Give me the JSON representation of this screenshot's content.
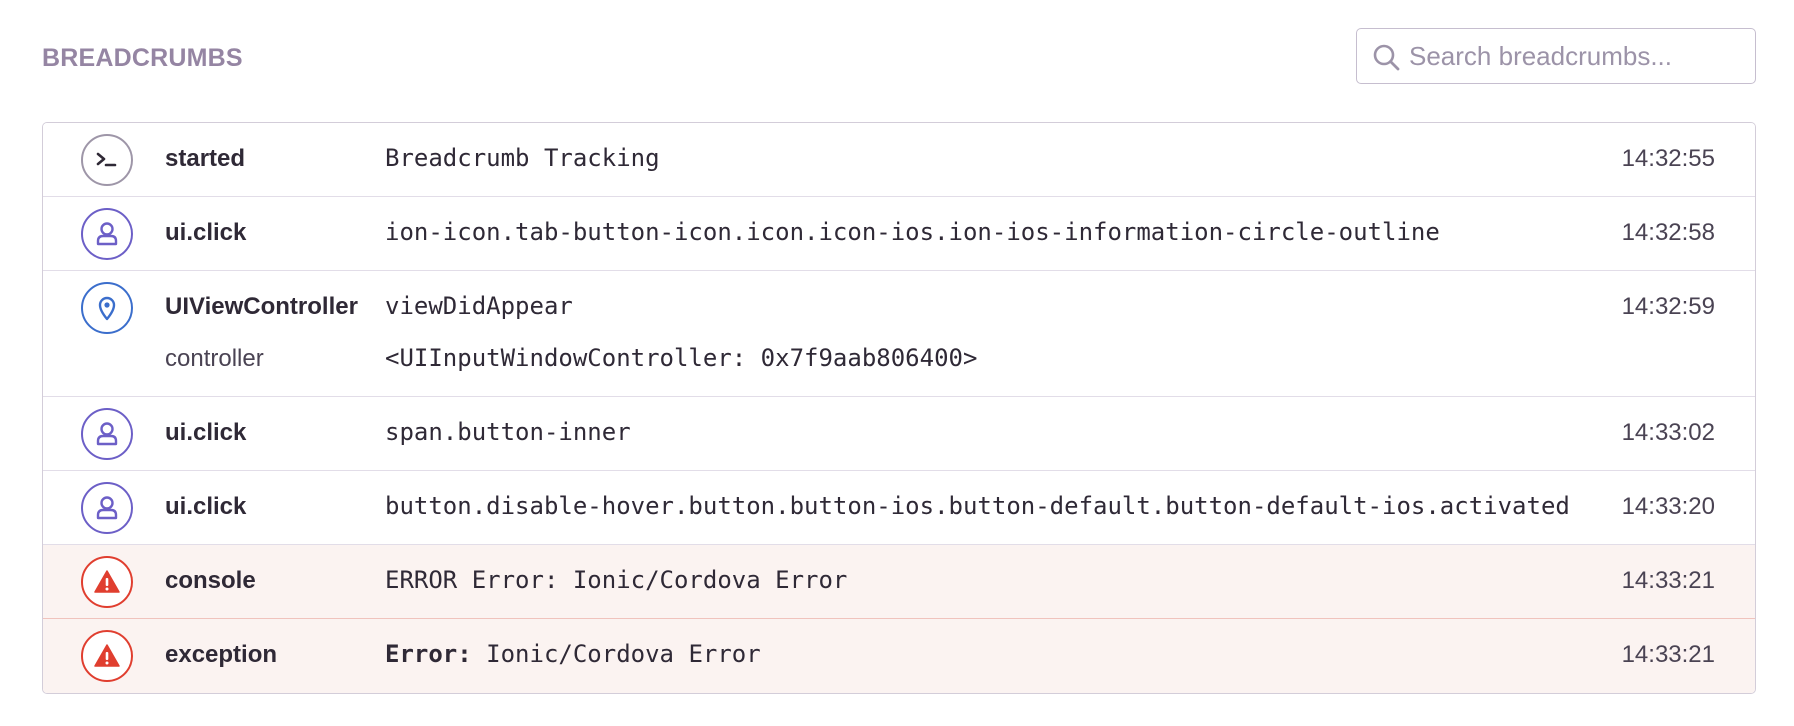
{
  "header": {
    "title": "BREADCRUMBS",
    "search_placeholder": "Search breadcrumbs..."
  },
  "crumbs": [
    {
      "type": "default",
      "icon": "terminal-icon",
      "category": "started",
      "message": "Breadcrumb Tracking",
      "time": "14:32:55"
    },
    {
      "type": "user",
      "icon": "user-icon",
      "category": "ui.click",
      "message": "ion-icon.tab-button-icon.icon.icon-ios.ion-ios-information-circle-outline",
      "time": "14:32:58"
    },
    {
      "type": "navigation",
      "icon": "location-pin-icon",
      "category": "UIViewController",
      "message": "viewDidAppear",
      "time": "14:32:59",
      "data_key": "controller",
      "data_value": "<UIInputWindowController: 0x7f9aab806400>"
    },
    {
      "type": "user",
      "icon": "user-icon",
      "category": "ui.click",
      "message": "span.button-inner",
      "time": "14:33:02"
    },
    {
      "type": "user",
      "icon": "user-icon",
      "category": "ui.click",
      "message": "button.disable-hover.button.button-ios.button-default.button-default-ios.activated",
      "time": "14:33:20"
    },
    {
      "type": "error",
      "icon": "warning-icon",
      "category": "console",
      "message": "ERROR Error: Ionic/Cordova Error",
      "time": "14:33:21"
    },
    {
      "type": "error",
      "icon": "warning-icon",
      "category": "exception",
      "message_prefix": "Error:",
      "message": "Ionic/Cordova Error",
      "time": "14:33:21"
    }
  ],
  "colors": {
    "title": "#9585a3",
    "user": "#6c5fc7",
    "navigation": "#3b6ecc",
    "error": "#e03e2f",
    "default": "#9e96a8",
    "error_row_bg": "#fbf3f1"
  }
}
